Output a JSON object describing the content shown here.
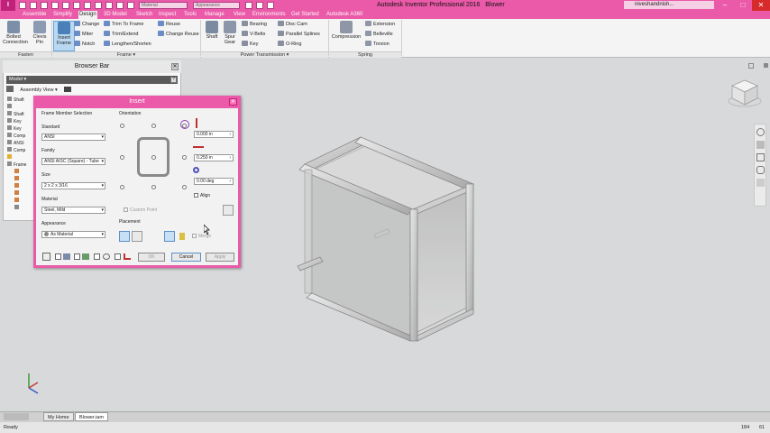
{
  "app": {
    "menu_label": "I",
    "title": "Autodesk Inventor Professional 2016",
    "document": "Blower",
    "material_box": "Material",
    "appearance_box": "Appearance",
    "signin": "niveshandnish...",
    "min": "–",
    "max": "□",
    "close": "✕"
  },
  "tabs": [
    "Assemble",
    "Simplify",
    "Design",
    "3D Model",
    "Sketch",
    "Inspect",
    "Tools",
    "Manage",
    "View",
    "Environments",
    "Get Started",
    "Autodesk A360"
  ],
  "active_tab": "Design",
  "ribbon": {
    "fasten": {
      "label": "Fasten",
      "bolted": "Bolted\nConnection",
      "clevis": "Clevis\nPin"
    },
    "frame": {
      "label": "Frame ▾",
      "insert": "Insert\nFrame",
      "change": "Change",
      "miter": "Miter",
      "notch": "Notch",
      "trim_to_frame": "Trim To Frame",
      "trim_extend": "Trim/Extend",
      "lengthen_shorten": "Lengthen/Shorten",
      "reuse": "Reuse",
      "change_reuse": "Change Reuse"
    },
    "power": {
      "label": "Power Transmission ▾",
      "shaft": "Shaft",
      "spur_gear": "Spur\nGear",
      "bearing": "Bearing",
      "vbelts": "V-Belts",
      "key": "Key",
      "disc_cam": "Disc Cam",
      "parallel_splines": "Parallel Splines",
      "oring": "O-Ring"
    },
    "spring": {
      "label": "Spring",
      "compression": "Compression",
      "extension": "Extension",
      "belleville": "Belleville",
      "torsion": "Torsion"
    }
  },
  "browser": {
    "title": "Browser Bar",
    "close": "✕",
    "help": "?",
    "model": "Model ▾",
    "view": "Assembly View ▾",
    "items": [
      "Shaft",
      "",
      "Shaft",
      "Key",
      "Key",
      "Comp",
      "ANSI",
      "Comp",
      "",
      "Frame",
      "",
      "",
      "",
      "",
      "",
      ""
    ]
  },
  "dialog": {
    "title": "Insert",
    "close": "✕",
    "frame_member_selection": "Frame Member Selection",
    "standard_label": "Standard",
    "standard_value": "ANSI",
    "family_label": "Family",
    "family_value": "ANSI AISC (Square) - Tube",
    "size_label": "Size",
    "size_value": "2 x 2 x 3/16",
    "material_label": "Material",
    "material_value": "Steel, Mild",
    "appearance_label": "Appearance",
    "appearance_value": "As Material",
    "orientation_label": "Orientation",
    "custom_point": "Custom Point",
    "offset_x": "0.000 in",
    "offset_y": "0.250 in",
    "rotation": "0.00 deg",
    "align": "Align",
    "placement_label": "Placement",
    "merge": "Merge",
    "ok": "OK",
    "cancel": "Cancel",
    "apply": "Apply"
  },
  "docs": {
    "home": "My Home",
    "blower": "Blower.iam"
  },
  "status": {
    "left": "Ready",
    "count1": "184",
    "count2": "61"
  }
}
